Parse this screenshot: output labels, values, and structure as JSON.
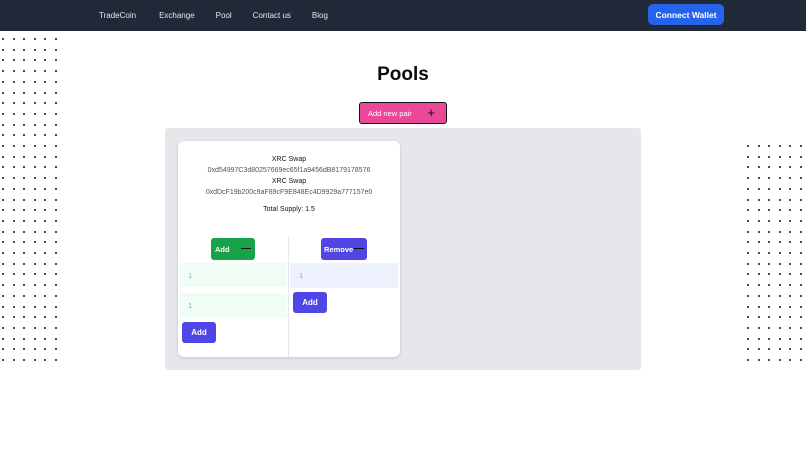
{
  "nav": {
    "links": [
      "TradeCoin",
      "Exchange",
      "Pool",
      "Contact us",
      "Blog"
    ],
    "connect_label": "Connect Wallet"
  },
  "page": {
    "title": "Pools",
    "add_pair_label": "Add new pair",
    "add_pair_icon": "+"
  },
  "pool_card": {
    "token_a_name": "XRC Swap",
    "token_a_address": "0xd54997C3d80257669ec65f1a9456dB8179178576",
    "token_b_name": "XRC Swap",
    "token_b_address": "0xdDcF19b200c9aF89cF9E848Ec4D9929a777157e0",
    "total_supply_label": "Total Supply: 1.5",
    "add_section": {
      "toggle_label": "Add",
      "input1_value": "1",
      "input2_value": "1",
      "submit_label": "Add"
    },
    "remove_section": {
      "toggle_label": "Remove",
      "input_value": "1",
      "submit_label": "Add"
    }
  },
  "colors": {
    "navbar": "#1f2937",
    "connect_button": "#2563eb",
    "add_pair_button": "#ec4899",
    "green_button": "#16a34a",
    "purple_button": "#4f46e5",
    "panel": "#e5e7eb"
  },
  "icons": [
    "plus-icon",
    "minus-icon"
  ]
}
